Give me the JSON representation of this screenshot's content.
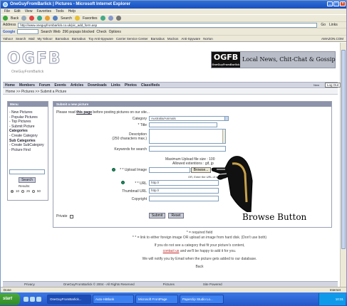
{
  "window": {
    "title": "OneGuyFromBarlick | Pictures - Microsoft Internet Explorer",
    "minimize": "_",
    "maximize": "□",
    "close": "x"
  },
  "menu": [
    "File",
    "Edit",
    "View",
    "Favorites",
    "Tools",
    "Help"
  ],
  "toolbar": {
    "back": "Back",
    "search": "Search",
    "favorites": "Favorites"
  },
  "address": {
    "label": "Address",
    "url": "http://www.oneguyfrombarlick.co.uk/pic_add_form.asp",
    "go": "Go",
    "links": "Links"
  },
  "google": {
    "label": "Google",
    "search_web": "Search Web",
    "popups": "296 popups blocked",
    "check": "Check",
    "options": "Options"
  },
  "linksbar": {
    "items": [
      "Yahoo!",
      "Search",
      "Mail",
      "My Yahoo!",
      "Barnabus",
      "Barnabus",
      "Toy Anti-Spyware",
      "Carrier Service Center",
      "Barnabus",
      "Mockos",
      "Anti-Spyware",
      "Norton"
    ],
    "right": "AMAZON.COM"
  },
  "site": {
    "logo": "OGFB",
    "logo_sub": "OneGuyFromBarlick",
    "banner_logo": "OGFB",
    "banner_logo_sub": "OneGuyFromBarlick",
    "banner_text": "Local News, Chit-Chat & Gossip",
    "nav": [
      "Home",
      "Members",
      "Forum",
      "Events",
      "Articles",
      "Downloads",
      "Links",
      "Photos",
      "Classifieds"
    ],
    "user_mini": "New",
    "login": "Log Out",
    "breadcrumb": "Home >> Pictures >> Submit a Picture"
  },
  "sidebar": {
    "header": "Menu",
    "items": [
      {
        "label": "- New Pictures",
        "bold": false
      },
      {
        "label": "- Popular Pictures",
        "bold": false
      },
      {
        "label": "- Top Pictures",
        "bold": false
      },
      {
        "label": "- Submit Picture",
        "bold": false
      },
      {
        "label": "Categories",
        "bold": true
      },
      {
        "label": "- Create Category",
        "bold": false
      },
      {
        "label": "Sub Categories",
        "bold": true
      },
      {
        "label": "- Create SubCategory",
        "bold": false
      },
      {
        "label": "",
        "bold": false
      },
      {
        "label": "- Picture Find",
        "bold": false
      }
    ],
    "search_button": "Search",
    "results_label": "Results:",
    "radio_options": [
      "10",
      "25",
      "50"
    ]
  },
  "form": {
    "header": "Submit a new picture",
    "intro_prefix": "Please read",
    "intro_link": "this page",
    "intro_suffix": "before posting pictures on our site...",
    "category_label": "Category",
    "category_value": "Australia/Animals",
    "title_label": "* Title",
    "description_label": "Description",
    "description_sub": "(250 characters max.)",
    "keywords_label": "Keywords for search",
    "max_size": "Maximum Upload file size : 100",
    "allowed_ext": "Allowed extentions : gif, jp",
    "upload_label": "* * Upload Image",
    "browse": "Browse...",
    "or_text": "OR, Enter the URL of an image in another site",
    "url_label": "* * URL",
    "url_value": "http://",
    "thumb_label": "Thumbnail URL",
    "thumb_value": "http://",
    "copyright_label": "Copyright",
    "private_label": "Private",
    "submit": "Submit",
    "reset": "Reset"
  },
  "footer_notes": {
    "required": "* = required field",
    "either": "* * = link to either foreign image OR upload an image from hard disk. (Don't use both)",
    "category_line": "If you do not see a category that fit your picture's content,",
    "contact_link": "contact us",
    "contact_suffix": "and we'll be happy to add it for you.",
    "notify": "We will notify you by Email when the picture gets added to our database.",
    "back": "Back"
  },
  "bottombar": {
    "items": [
      "Privacy",
      "OneGuyFromBarlick © 2004 - All Rights Reserved",
      "Pictures",
      "Site Powered"
    ]
  },
  "statusbar": {
    "left": "Done",
    "right": "Internet"
  },
  "taskbar": {
    "start": "start",
    "tasks": [
      "OneGuyFromBarlick...",
      "Auto-HiBlank",
      "Microsoft FrontPage",
      "Paperclip Studio Lo..."
    ],
    "clock": "10:31"
  },
  "annotation": {
    "callout": "Browse Button"
  },
  "colors": {
    "titlebar": "#2f6fd8",
    "chrome": "#ece9d8",
    "site_nav": "#d3d6e0",
    "panel_header": "#8c93aa",
    "link_red": "#c0282a"
  }
}
